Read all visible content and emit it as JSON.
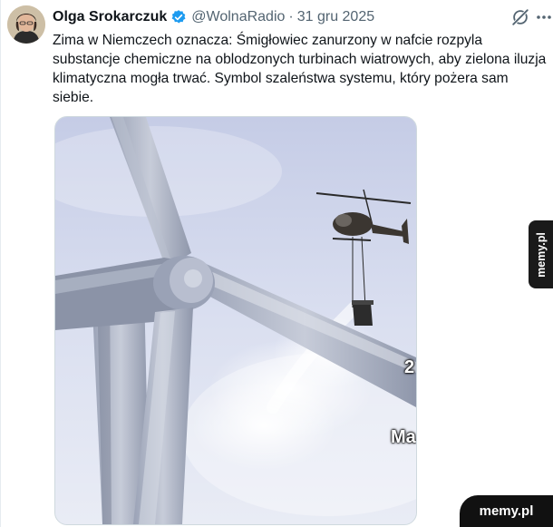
{
  "author": {
    "name": "Olga Srokarczuk",
    "handle": "@WolnaRadio",
    "separator": "·",
    "date": "31 gru 2025",
    "verified_color": "#1d9bf0"
  },
  "tweet": {
    "text": "Zima w Niemczech oznacza: Śmigłowiec zanurzony w nafcie rozpyla substancje chemiczne na oblodzonych turbinach wiatrowych, aby zielona iluzja klimatyczna mogła trwać.  Symbol szaleństwa systemu, który pożera sam siebie."
  },
  "media": {
    "overlay_text_1": "2",
    "overlay_text_2": "Ma"
  },
  "icons": {
    "grok": "grok-icon",
    "more": "more-icon",
    "verified": "verified-badge-icon"
  },
  "watermarks": {
    "side": "memy.pl",
    "bottom": "memy.pl"
  }
}
